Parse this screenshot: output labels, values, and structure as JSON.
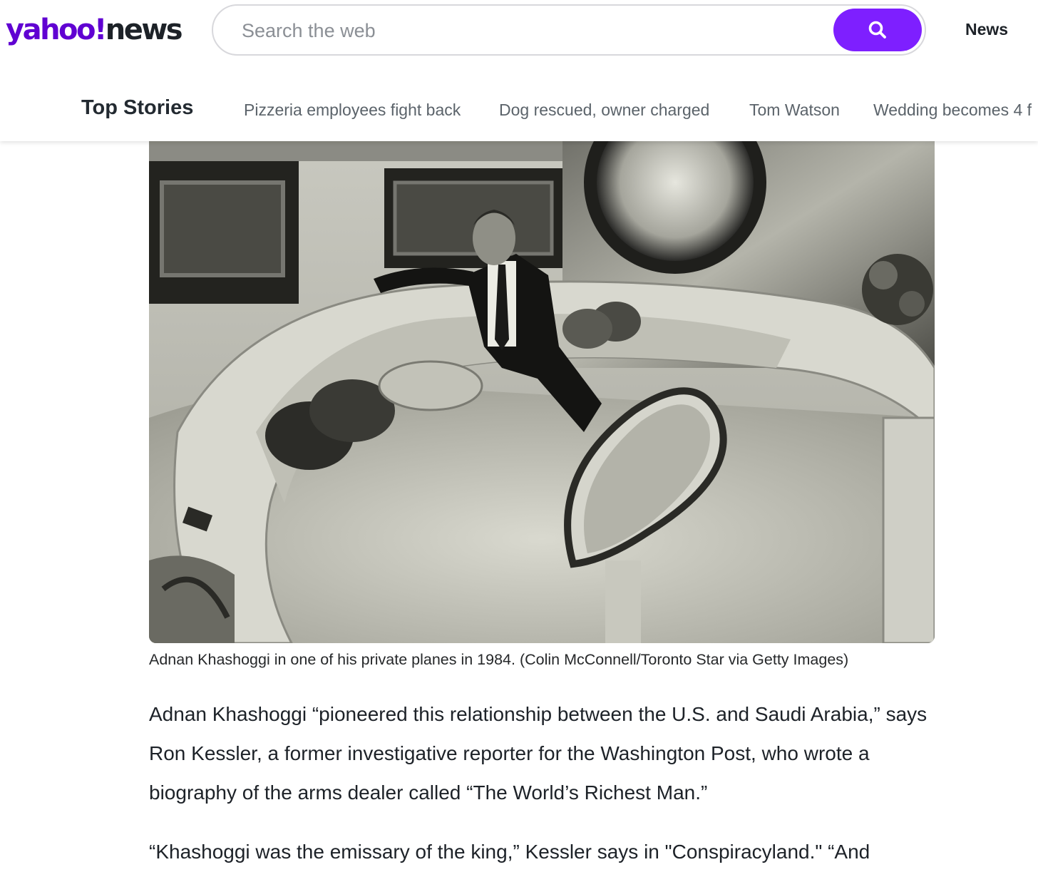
{
  "header": {
    "logo": {
      "brand": "yahoo!",
      "section": "news"
    },
    "search": {
      "placeholder": "Search the web"
    },
    "nav_news": "News",
    "colors": {
      "brand": "#6001d2",
      "search_button": "#7e1fff"
    }
  },
  "subnav": {
    "title": "Top Stories",
    "items": [
      "Pizzeria employees fight back",
      "Dog rescued, owner charged",
      "Tom Watson",
      "Wedding becomes 4 f"
    ]
  },
  "article": {
    "photo_caption": "Adnan Khashoggi in one of his private planes in 1984. (Colin McConnell/Toronto Star via Getty Images)",
    "paragraphs": [
      "Adnan Khashoggi “pioneered this relationship between the U.S. and Saudi Arabia,” says Ron Kessler, a former investigative reporter for the Washington Post, who wrote a biography of the arms dealer called “The World’s Richest Man.”",
      "“Khashoggi was the emissary of the king,” Kessler says in \"Conspiracyland.\" “And"
    ]
  }
}
